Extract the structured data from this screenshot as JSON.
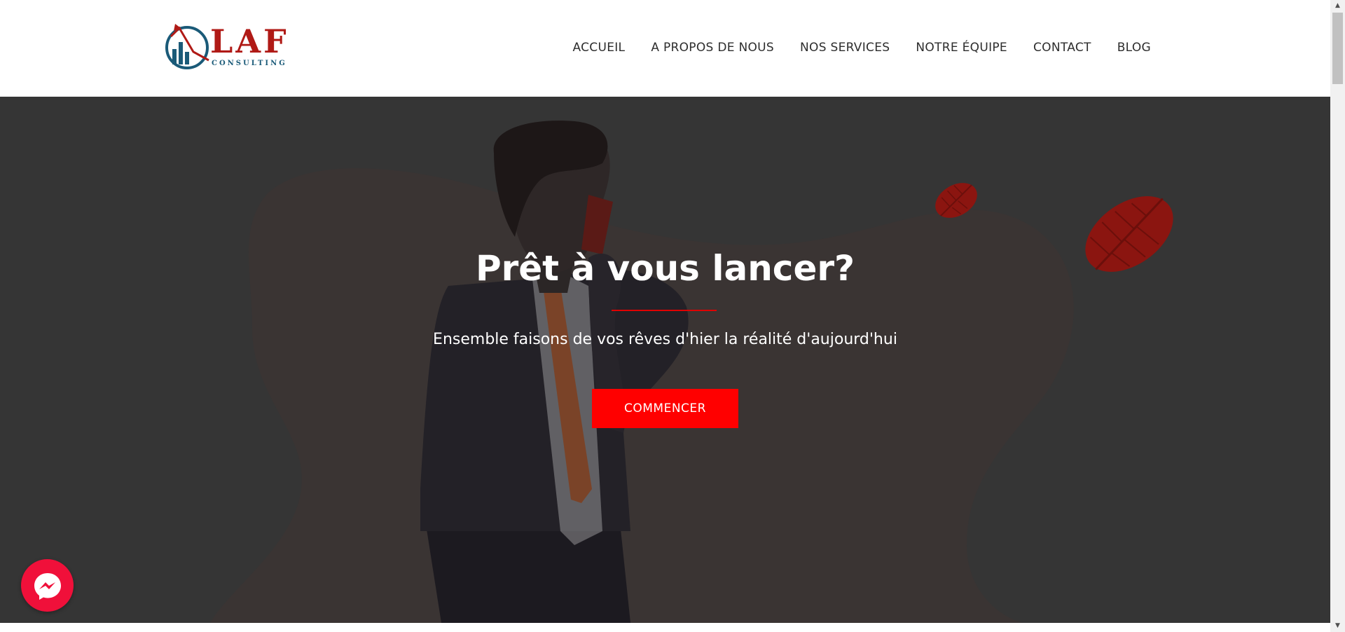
{
  "brand": {
    "name": "LAF",
    "tagline": "CONSULTING"
  },
  "nav": {
    "items": [
      {
        "label": "ACCUEIL"
      },
      {
        "label": "A PROPOS DE NOUS"
      },
      {
        "label": "NOS SERVICES"
      },
      {
        "label": "NOTRE ÉQUIPE"
      },
      {
        "label": "CONTACT"
      },
      {
        "label": "BLOG"
      }
    ]
  },
  "hero": {
    "title": "Prêt à vous lancer?",
    "subtitle": "Ensemble faisons de vos rêves d'hier la réalité d'aujourd'hui",
    "cta_label": "COMMENCER"
  },
  "colors": {
    "accent": "#ff0000",
    "brand_red": "#b01a16",
    "brand_blue": "#1a5a78",
    "hero_bg": "#353535",
    "messenger": "#f0103a"
  },
  "icons": {
    "messenger": "messenger-icon",
    "scroll_up": "scroll-up-arrow-icon",
    "scroll_down": "scroll-down-arrow-icon"
  }
}
